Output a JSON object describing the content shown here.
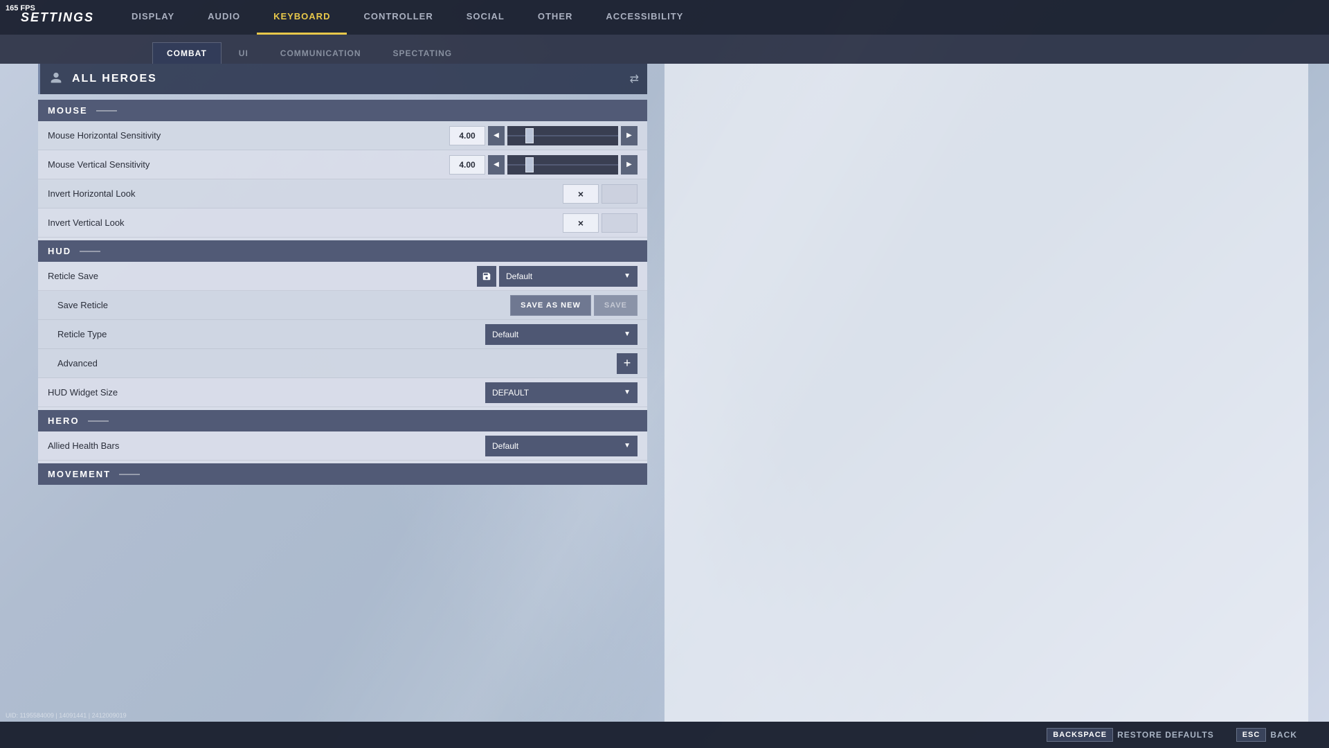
{
  "fps": "165 FPS",
  "appTitle": "SETTINGS",
  "nav": {
    "items": [
      {
        "id": "display",
        "label": "DISPLAY",
        "active": false
      },
      {
        "id": "audio",
        "label": "AUDIO",
        "active": false
      },
      {
        "id": "keyboard",
        "label": "KEYBOARD",
        "active": true
      },
      {
        "id": "controller",
        "label": "CONTROLLER",
        "active": false
      },
      {
        "id": "social",
        "label": "SOCIAL",
        "active": false
      },
      {
        "id": "other",
        "label": "OTHER",
        "active": false
      },
      {
        "id": "accessibility",
        "label": "ACCESSIBILITY",
        "active": false
      }
    ]
  },
  "subTabs": {
    "items": [
      {
        "id": "combat",
        "label": "COMBAT",
        "active": true
      },
      {
        "id": "ui",
        "label": "UI",
        "active": false
      },
      {
        "id": "communication",
        "label": "COMMUNICATION",
        "active": false
      },
      {
        "id": "spectating",
        "label": "SPECTATING",
        "active": false
      }
    ]
  },
  "heroesBar": {
    "title": "ALL HEROES",
    "iconLabel": "heroes-icon",
    "swapLabel": "⇄"
  },
  "sections": {
    "mouse": {
      "title": "MOUSE",
      "rows": [
        {
          "label": "Mouse Horizontal Sensitivity",
          "type": "slider",
          "value": "4.00",
          "sliderPos": 20
        },
        {
          "label": "Mouse Vertical Sensitivity",
          "type": "slider",
          "value": "4.00",
          "sliderPos": 20
        },
        {
          "label": "Invert Horizontal Look",
          "type": "toggle",
          "value": "×"
        },
        {
          "label": "Invert Vertical Look",
          "type": "toggle",
          "value": "×"
        }
      ]
    },
    "hud": {
      "title": "HUD",
      "rows": [
        {
          "label": "Reticle Save",
          "type": "reticle-dropdown",
          "value": "Default"
        },
        {
          "label": "Save Reticle",
          "type": "save-buttons",
          "btn1": "SAVE AS NEW",
          "btn2": "SAVE",
          "isSub": true
        },
        {
          "label": "Reticle Type",
          "type": "dropdown",
          "value": "Default",
          "isSub": true
        },
        {
          "label": "Advanced",
          "type": "expand",
          "isSub": true
        },
        {
          "label": "HUD Widget Size",
          "type": "dropdown",
          "value": "DEFAULT"
        }
      ]
    },
    "hero": {
      "title": "HERO",
      "rows": [
        {
          "label": "Allied Health Bars",
          "type": "dropdown",
          "value": "Default"
        }
      ]
    },
    "movement": {
      "title": "MOVEMENT",
      "rows": []
    }
  },
  "bottomBar": {
    "restore": {
      "key": "BACKSPACE",
      "label": "RESTORE DEFAULTS"
    },
    "back": {
      "key": "ESC",
      "label": "BACK"
    }
  },
  "debugInfo": "UID: 1195584009 | 14091441 | 2412009019"
}
